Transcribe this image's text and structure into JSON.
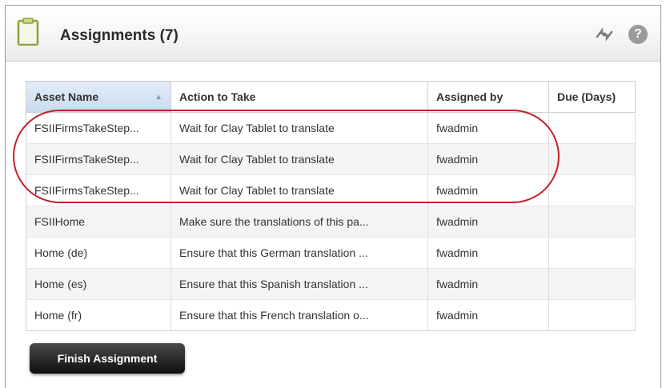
{
  "header": {
    "title": "Assignments (7)",
    "icons": {
      "clipboard": "clipboard-icon",
      "refresh": "refresh-icon",
      "help": "help-icon"
    },
    "help_glyph": "?"
  },
  "table": {
    "columns": [
      "Asset Name",
      "Action to Take",
      "Assigned by",
      "Due (Days)"
    ],
    "sorted_column": "Asset Name",
    "sort_indicator": "▲",
    "rows": [
      {
        "asset": "FSIIFirmsTakeStep...",
        "action": "Wait for Clay Tablet to translate",
        "assigned_by": "fwadmin",
        "due": ""
      },
      {
        "asset": "FSIIFirmsTakeStep...",
        "action": "Wait for Clay Tablet to translate",
        "assigned_by": "fwadmin",
        "due": ""
      },
      {
        "asset": "FSIIFirmsTakeStep...",
        "action": "Wait for Clay Tablet to translate",
        "assigned_by": "fwadmin",
        "due": ""
      },
      {
        "asset": "FSIIHome",
        "action": "Make sure the translations of this pa...",
        "assigned_by": "fwadmin",
        "due": ""
      },
      {
        "asset": "Home (de)",
        "action": "Ensure that this German translation ...",
        "assigned_by": "fwadmin",
        "due": ""
      },
      {
        "asset": "Home (es)",
        "action": "Ensure that this Spanish translation ...",
        "assigned_by": "fwadmin",
        "due": ""
      },
      {
        "asset": "Home (fr)",
        "action": "Ensure that this French translation o...",
        "assigned_by": "fwadmin",
        "due": ""
      }
    ]
  },
  "actions": {
    "finish_label": "Finish Assignment"
  },
  "colors": {
    "link": "#2f6fb1",
    "highlight": "#c32127",
    "button": "#1a1a1a"
  }
}
